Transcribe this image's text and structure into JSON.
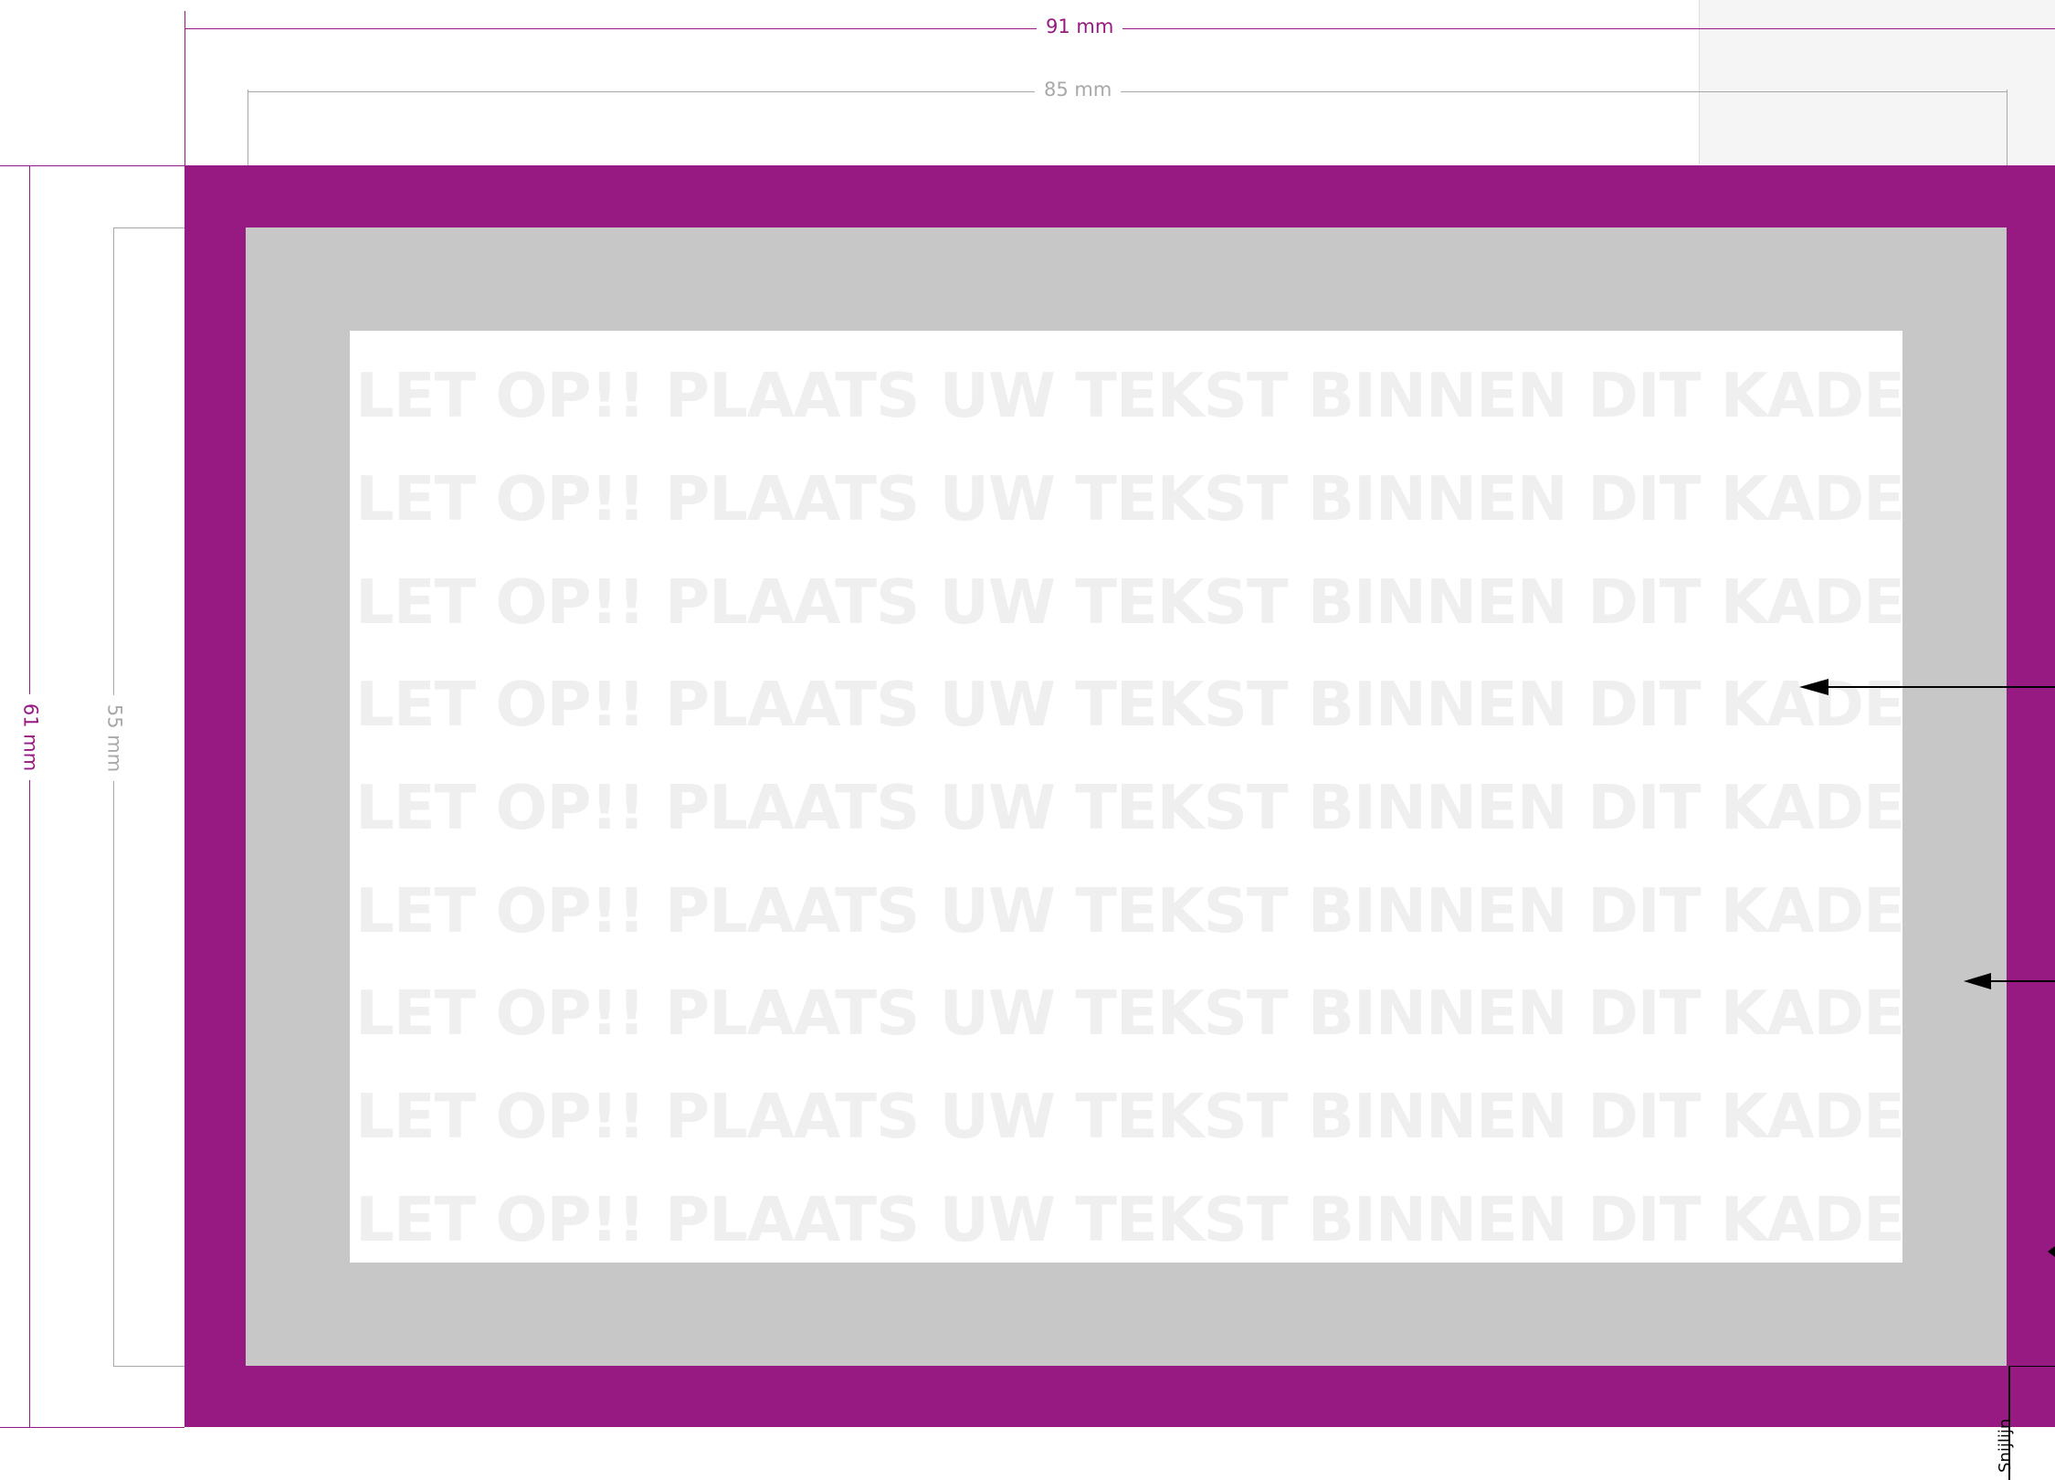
{
  "colors": {
    "bleed": "#961a82",
    "trim_zone": "#c6c7c6",
    "safe_area": "#ffffff",
    "outer_dimension": "#961a82",
    "inner_dimension": "#a8a8a8",
    "watermark_text": "#efefef",
    "arrow": "#000000",
    "panel": "#f5f5f5"
  },
  "dimensions": {
    "outer_width": "91 mm",
    "inner_width": "85 mm",
    "outer_height": "61 mm",
    "inner_height": "55 mm"
  },
  "watermark": {
    "lines": [
      "LET OP!! PLAATS UW TEKST BINNEN DIT KADER",
      "LET OP!! PLAATS UW TEKST BINNEN DIT KADER",
      "LET OP!! PLAATS UW TEKST BINNEN DIT KADER",
      "LET OP!! PLAATS UW TEKST BINNEN DIT KADER",
      "LET OP!! PLAATS UW TEKST BINNEN DIT KADER",
      "LET OP!! PLAATS UW TEKST BINNEN DIT KADER",
      "LET OP!! PLAATS UW TEKST BINNEN DIT KADER",
      "LET OP!! PLAATS UW TEKST BINNEN DIT KADER",
      "LET OP!! PLAATS UW TEKST BINNEN DIT KADER"
    ]
  },
  "annotations": {
    "cut_line_label": "Snijlijn"
  }
}
